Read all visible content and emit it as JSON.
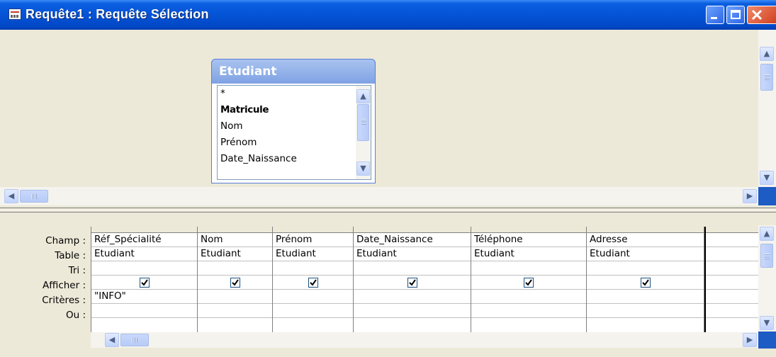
{
  "window": {
    "title": "Requête1 : Requête Sélection"
  },
  "field_list": {
    "title": "Etudiant",
    "items": [
      "*",
      "Matricule",
      "Nom",
      "Prénom",
      "Date_Naissance"
    ]
  },
  "grid": {
    "row_labels": [
      "Champ :",
      "Table :",
      "Tri :",
      "Afficher :",
      "Critères :",
      "Ou :"
    ],
    "columns": [
      {
        "champ": "Réf_Spécialité",
        "table": "Etudiant",
        "tri": "",
        "afficher": true,
        "criteres": "\"INFO\"",
        "ou": ""
      },
      {
        "champ": "Nom",
        "table": "Etudiant",
        "tri": "",
        "afficher": true,
        "criteres": "",
        "ou": ""
      },
      {
        "champ": "Prénom",
        "table": "Etudiant",
        "tri": "",
        "afficher": true,
        "criteres": "",
        "ou": ""
      },
      {
        "champ": "Date_Naissance",
        "table": "Etudiant",
        "tri": "",
        "afficher": true,
        "criteres": "",
        "ou": ""
      },
      {
        "champ": "Téléphone",
        "table": "Etudiant",
        "tri": "",
        "afficher": true,
        "criteres": "",
        "ou": ""
      },
      {
        "champ": "Adresse",
        "table": "Etudiant",
        "tri": "",
        "afficher": true,
        "criteres": "",
        "ou": ""
      },
      {
        "champ": "",
        "table": "",
        "tri": "",
        "afficher": false,
        "criteres": "",
        "ou": ""
      }
    ]
  },
  "colors": {
    "titlebar": "#0553d6",
    "field_list_header": "#7fa2e3",
    "window_bg": "#ece9d8"
  }
}
